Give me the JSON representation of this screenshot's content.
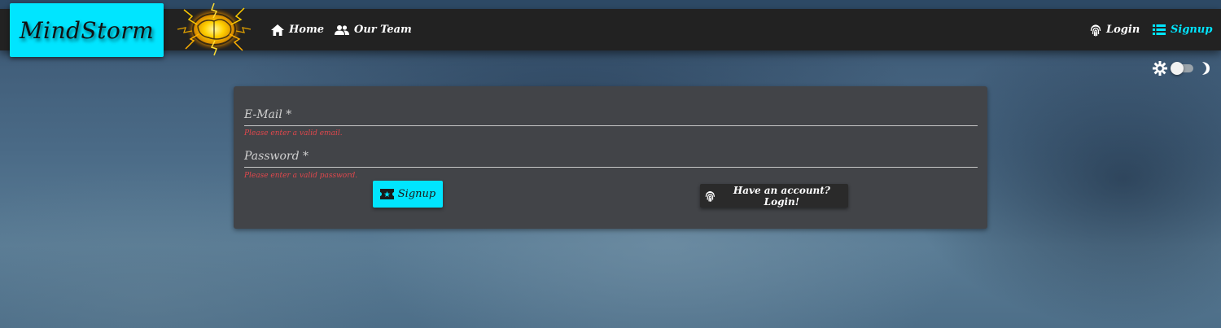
{
  "brand": {
    "name": "MindStorm",
    "accent_color": "#00e5ff",
    "logo_icon": "brain-storm-logo"
  },
  "nav": {
    "left": [
      {
        "label": "Home",
        "icon": "home-icon"
      },
      {
        "label": "Our Team",
        "icon": "group-icon"
      }
    ],
    "right": [
      {
        "label": "Login",
        "icon": "fingerprint-icon"
      },
      {
        "label": "Signup",
        "icon": "list-icon",
        "active": true
      }
    ]
  },
  "theme_toggle": {
    "left_icon": "sun-icon",
    "right_icon": "moon-icon",
    "dark_mode": false
  },
  "form": {
    "email": {
      "label": "E-Mail *",
      "value": "",
      "error": "Please enter a valid email."
    },
    "password": {
      "label": "Password *",
      "value": "",
      "error": "Please enter a valid password."
    },
    "submit_label": "Signup",
    "submit_icon": "ticket-icon",
    "switch_label": "Have an account? Login!",
    "switch_icon": "fingerprint-icon",
    "error_color": "#e0474c"
  }
}
